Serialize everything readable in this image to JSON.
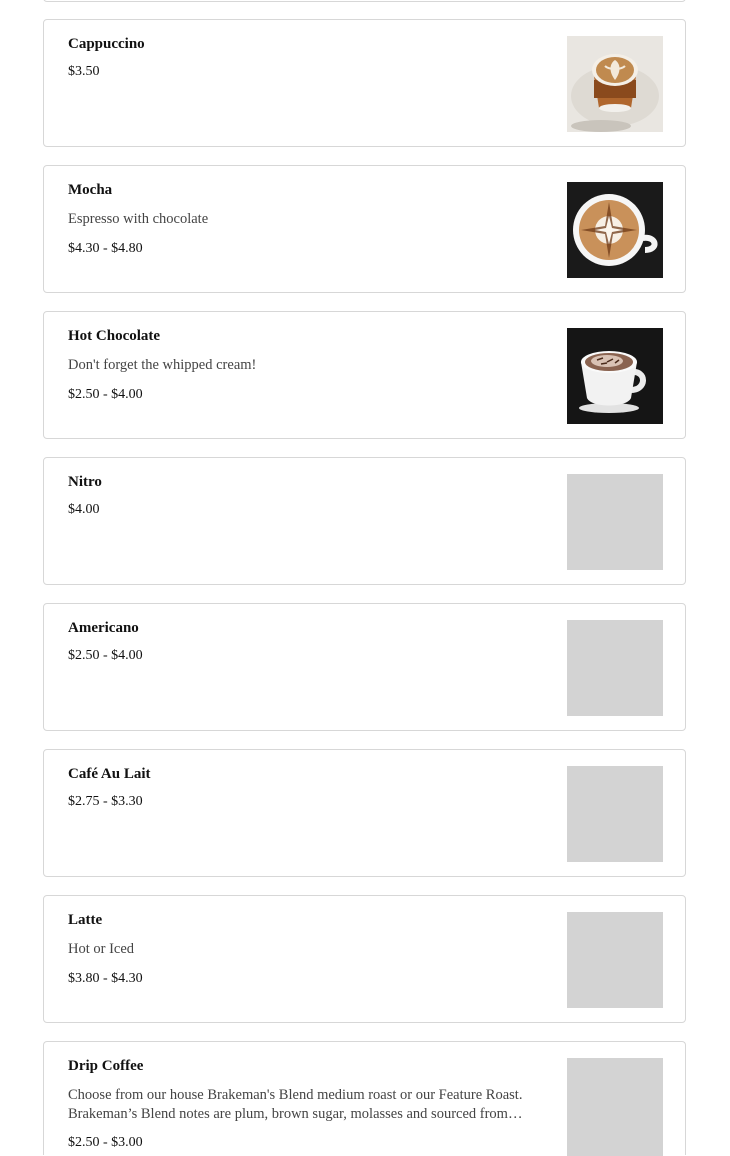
{
  "menu_items": [
    {
      "name": "Cappuccino",
      "description": "",
      "price": "$3.50",
      "image": "cappuccino-photo"
    },
    {
      "name": "Mocha",
      "description": "Espresso with chocolate",
      "price": "$4.30 - $4.80",
      "image": "mocha-photo"
    },
    {
      "name": "Hot Chocolate",
      "description": "Don't forget the whipped cream!",
      "price": "$2.50 - $4.00",
      "image": "hot-chocolate-photo"
    },
    {
      "name": "Nitro",
      "description": "",
      "price": "$4.00",
      "image": "placeholder"
    },
    {
      "name": "Americano",
      "description": "",
      "price": "$2.50 - $4.00",
      "image": "placeholder"
    },
    {
      "name": "Café Au Lait",
      "description": "",
      "price": "$2.75 - $3.30",
      "image": "placeholder"
    },
    {
      "name": "Latte",
      "description": "Hot or Iced",
      "price": "$3.80 - $4.30",
      "image": "placeholder"
    },
    {
      "name": "Drip Coffee",
      "description": "Choose from our house Brakeman's Blend medium roast or our Feature Roast. Brakeman’s Blend notes are plum, brown sugar, molasses and sourced from…",
      "price": "$2.50 - $3.00",
      "image": "placeholder"
    }
  ],
  "colors": {
    "border": "#d7d7d7",
    "placeholder": "#d3d3d3",
    "text": "#111111",
    "muted": "#444444"
  }
}
